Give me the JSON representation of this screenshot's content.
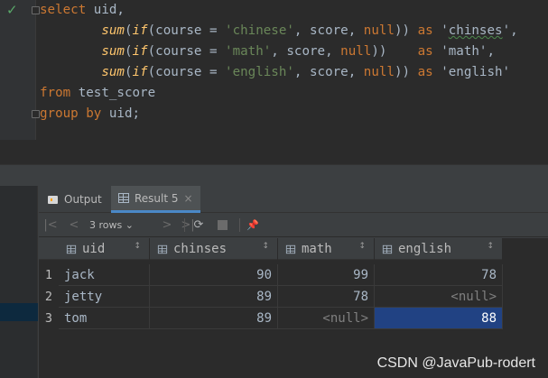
{
  "editor": {
    "lines": [
      {
        "parts": [
          {
            "t": "select",
            "c": "kw"
          },
          {
            "t": " uid,",
            "c": "ident"
          }
        ]
      },
      {
        "parts": [
          {
            "t": "        ",
            "c": "ident"
          },
          {
            "t": "sum",
            "c": "fn"
          },
          {
            "t": "(",
            "c": "ident"
          },
          {
            "t": "if",
            "c": "fn"
          },
          {
            "t": "(course = ",
            "c": "ident"
          },
          {
            "t": "'chinese'",
            "c": "str"
          },
          {
            "t": ", score, ",
            "c": "ident"
          },
          {
            "t": "null",
            "c": "kw"
          },
          {
            "t": ")) ",
            "c": "ident"
          },
          {
            "t": "as",
            "c": "kw"
          },
          {
            "t": " '",
            "c": "ident"
          },
          {
            "t": "chinses",
            "c": "ident typo"
          },
          {
            "t": "',",
            "c": "ident"
          }
        ]
      },
      {
        "parts": [
          {
            "t": "        ",
            "c": "ident"
          },
          {
            "t": "sum",
            "c": "fn"
          },
          {
            "t": "(",
            "c": "ident"
          },
          {
            "t": "if",
            "c": "fn"
          },
          {
            "t": "(course = ",
            "c": "ident"
          },
          {
            "t": "'math'",
            "c": "str"
          },
          {
            "t": ", score, ",
            "c": "ident"
          },
          {
            "t": "null",
            "c": "kw"
          },
          {
            "t": "))    ",
            "c": "ident"
          },
          {
            "t": "as",
            "c": "kw"
          },
          {
            "t": " 'math',",
            "c": "ident"
          }
        ]
      },
      {
        "parts": [
          {
            "t": "        ",
            "c": "ident"
          },
          {
            "t": "sum",
            "c": "fn"
          },
          {
            "t": "(",
            "c": "ident"
          },
          {
            "t": "if",
            "c": "fn"
          },
          {
            "t": "(course = ",
            "c": "ident"
          },
          {
            "t": "'english'",
            "c": "str"
          },
          {
            "t": ", score, ",
            "c": "ident"
          },
          {
            "t": "null",
            "c": "kw"
          },
          {
            "t": ")) ",
            "c": "ident"
          },
          {
            "t": "as",
            "c": "kw"
          },
          {
            "t": " 'english'",
            "c": "ident"
          }
        ]
      },
      {
        "parts": [
          {
            "t": "from",
            "c": "kw"
          },
          {
            "t": " test_score",
            "c": "ident"
          }
        ]
      },
      {
        "parts": [
          {
            "t": "group by",
            "c": "kw"
          },
          {
            "t": " uid;",
            "c": "ident"
          }
        ]
      }
    ]
  },
  "tabs": {
    "output_label": "Output",
    "result_label": "Result 5",
    "close_glyph": "×"
  },
  "toolbar": {
    "first_glyph": "|<",
    "prev_glyph": "<",
    "rows_label": "3 rows",
    "rows_chevron": "⌄",
    "next_glyph": ">",
    "last_glyph": ">|",
    "refresh_glyph": "⟳",
    "pin_glyph": "📌"
  },
  "grid": {
    "columns": [
      {
        "name": "uid",
        "sort": "↕"
      },
      {
        "name": "chinses",
        "sort": "↕"
      },
      {
        "name": "math",
        "sort": "↕"
      },
      {
        "name": "english",
        "sort": "↕"
      }
    ],
    "rows": [
      {
        "num": "1",
        "uid": "jack",
        "chinses": "90",
        "math": "99",
        "english": "78"
      },
      {
        "num": "2",
        "uid": "jetty",
        "chinses": "89",
        "math": "78",
        "english": "<null>"
      },
      {
        "num": "3",
        "uid": "tom",
        "chinses": "89",
        "math": "<null>",
        "english": "88"
      }
    ]
  },
  "watermark": "CSDN @JavaPub-rodert",
  "colors": {
    "keyword": "#cc7832",
    "string": "#6a8759",
    "function": "#ffc66d",
    "selection": "#214283",
    "accent": "#4a88c7"
  },
  "icons": [
    "check-icon",
    "fold-icon",
    "output-icon",
    "table-icon",
    "refresh-icon",
    "stop-icon",
    "pin-icon"
  ]
}
